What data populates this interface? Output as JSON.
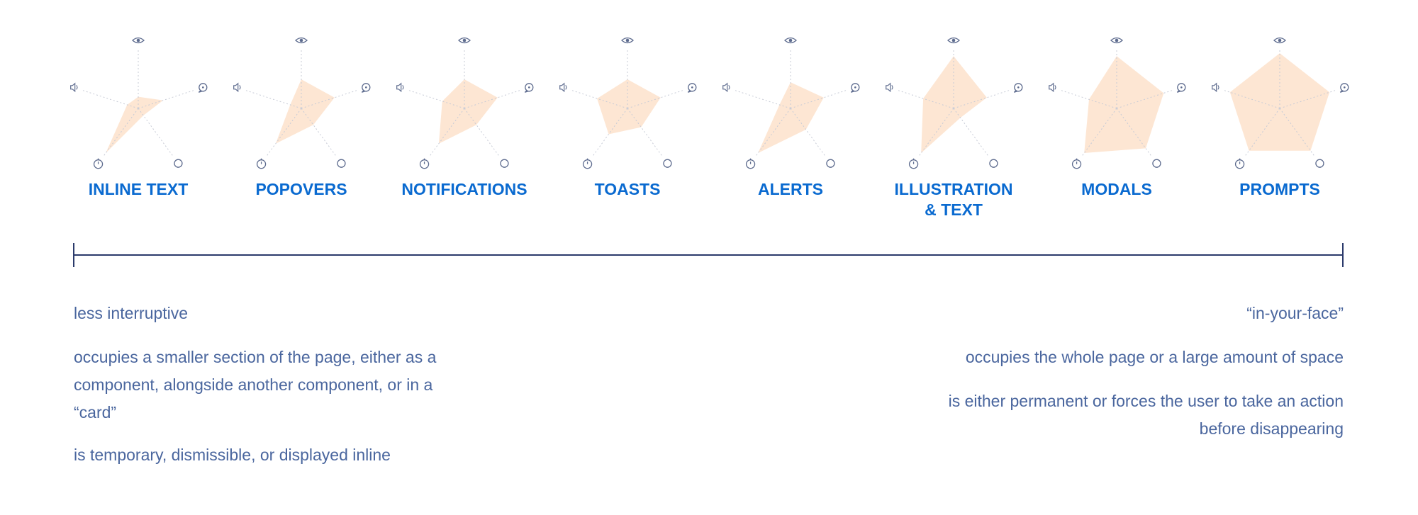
{
  "chart_data": {
    "type": "radar",
    "axes": [
      {
        "icon": "eye-icon"
      },
      {
        "icon": "chat-icon"
      },
      {
        "icon": "clock-icon"
      },
      {
        "icon": "timer-icon"
      },
      {
        "icon": "speaker-icon"
      }
    ],
    "scale_max": 1,
    "fill_color": "#fde6d3",
    "axis_color": "#c7cbd6",
    "icon_color": "#5d6b8e",
    "label_color": "#0a6ad0",
    "items": [
      {
        "label": "INLINE TEXT",
        "values": [
          0.2,
          0.45,
          0.15,
          0.95,
          0.2
        ]
      },
      {
        "label": "POPOVERS",
        "values": [
          0.5,
          0.6,
          0.35,
          0.75,
          0.2
        ]
      },
      {
        "label": "NOTIFICATIONS",
        "values": [
          0.5,
          0.6,
          0.35,
          0.75,
          0.4
        ]
      },
      {
        "label": "TOASTS",
        "values": [
          0.5,
          0.6,
          0.4,
          0.55,
          0.55
        ]
      },
      {
        "label": "ALERTS",
        "values": [
          0.45,
          0.6,
          0.45,
          0.95,
          0.2
        ]
      },
      {
        "label": "ILLUSTRATION\n& TEXT",
        "values": [
          0.9,
          0.6,
          0.2,
          0.95,
          0.55
        ]
      },
      {
        "label": "MODALS",
        "values": [
          0.9,
          0.85,
          0.85,
          0.95,
          0.5
        ]
      },
      {
        "label": "PROMPTS",
        "values": [
          0.95,
          0.9,
          0.9,
          0.9,
          0.9
        ]
      }
    ]
  },
  "left": {
    "lines": [
      "less interruptive",
      "occupies a smaller section of the page, either as a component, alongside another component, or in a “card”",
      "is temporary, dismissible, or displayed inline"
    ]
  },
  "right": {
    "lines": [
      "“in-your-face”",
      "occupies the whole page or a large amount of space",
      "is either permanent or forces the user to take an action before disappearing"
    ]
  }
}
